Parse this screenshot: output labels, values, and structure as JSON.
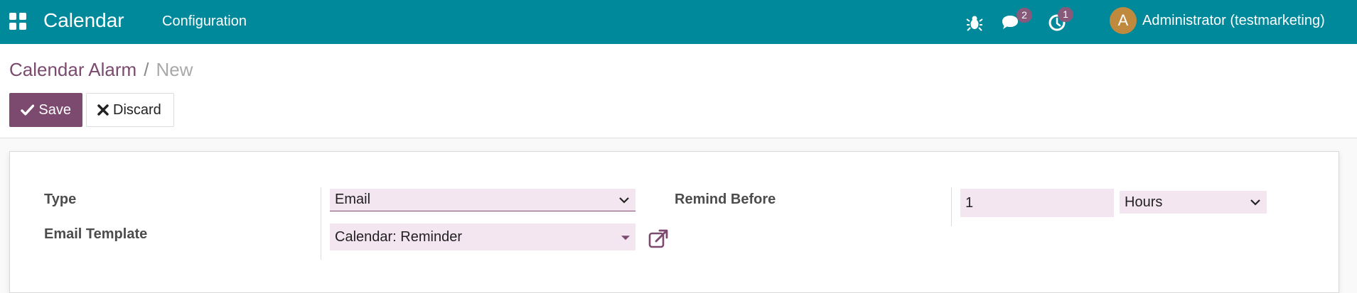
{
  "navbar": {
    "app_title": "Calendar",
    "menu_items": [
      "Configuration"
    ],
    "messages_count": "2",
    "activities_count": "1",
    "avatar_letter": "A",
    "user_name": "Administrator (testmarketing)",
    "color": "#00899a"
  },
  "breadcrumb": {
    "parent": "Calendar Alarm",
    "separator": "/",
    "current": "New"
  },
  "buttons": {
    "save_label": "Save",
    "discard_label": "Discard"
  },
  "form": {
    "type_label": "Type",
    "type_value": "Email",
    "email_template_label": "Email Template",
    "email_template_value": "Calendar: Reminder",
    "remind_before_label": "Remind Before",
    "remind_before_value": "1",
    "remind_unit_value": "Hours"
  },
  "colors": {
    "primary": "#7c4a6e",
    "navbar": "#00899a",
    "input_bg": "#f3e6f0",
    "badge": "#875a7b"
  },
  "icons": [
    "apps-grid-icon",
    "bug-icon",
    "chat-icon",
    "activity-clock-icon",
    "check-icon",
    "times-icon",
    "chevron-down-icon",
    "external-link-icon"
  ]
}
